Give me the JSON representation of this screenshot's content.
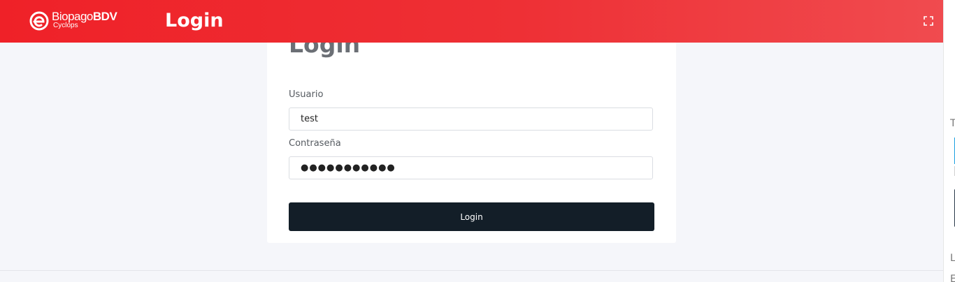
{
  "header": {
    "logo_brand": "Biopago",
    "logo_brand_bold": "BDV",
    "logo_sub": "Cyclops",
    "title": "Login",
    "fullscreen_icon": "expand-icon"
  },
  "login_card": {
    "title": "Login",
    "username": {
      "label": "Usuario",
      "value": "test"
    },
    "password": {
      "label": "Contraseña",
      "value": "●●●●●●●●●●●"
    },
    "submit_label": "Login"
  },
  "right_panel": {
    "letters": [
      "T",
      "L",
      "E"
    ]
  },
  "colors": {
    "header_red": "#ef2128",
    "button_dark": "#131e28",
    "background": "#f5f6fa"
  }
}
